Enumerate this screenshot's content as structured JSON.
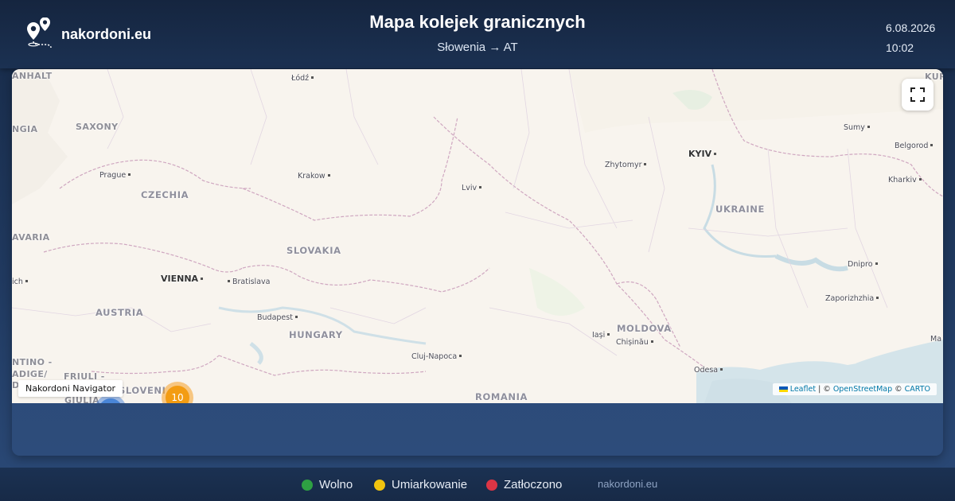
{
  "header": {
    "brand_name": "nakordoni.eu",
    "title": "Mapa kolejek granicznych",
    "subtitle": "Słowenia → AT",
    "date": "6.08.2026",
    "time": "10:02"
  },
  "map": {
    "labels": {
      "anhalt": "ANHALT",
      "lodz": "Łódź",
      "kursk": "KURSK",
      "saxony": "SAXONY",
      "ngia": "NGIA",
      "sumy": "Sumy",
      "belgorod": "Belgorod",
      "prague": "Prague",
      "krakow": "Krakow",
      "zhytomyr": "Zhytomyr",
      "kyiv": "KYIV",
      "czechia": "CZECHIA",
      "lviv": "Lviv",
      "kharkiv": "Kharkiv",
      "ukraine": "UKRAINE",
      "bavaria": "AVARIA",
      "slovakia": "SLOVAKIA",
      "dnipro": "Dnipro",
      "munich": "ich",
      "vienna": "VIENNA",
      "bratislava": "Bratislava",
      "zaporizhzhia": "Zaporizhzhia",
      "austria": "AUSTRIA",
      "budapest": "Budapest",
      "iasi": "Iași",
      "moldova": "MOLDOVA",
      "chisinau": "Chișinău",
      "hungary": "HUNGARY",
      "ma": "Ma",
      "trentino": "NTINO -",
      "adige": "ADIGE/",
      "dt": "DT",
      "cluj": "Cluj-Napoca",
      "odesa": "Odesa",
      "friuli": "FRIULI -",
      "giulia": "GIULIA",
      "slovenia": "SLOVENI",
      "romania": "ROMANIA"
    },
    "navigator_label": "Nakordoni Navigator",
    "attribution": {
      "leaflet": "Leaflet",
      "sep1": " | © ",
      "osm": "OpenStreetMap",
      "sep2": " © ",
      "carto": "CARTO"
    },
    "clusters": [
      {
        "label": "10",
        "color": "#f39c12"
      },
      {
        "label": "",
        "color": "#4a86d8"
      }
    ]
  },
  "legend": [
    {
      "label": "Wolno",
      "color": "#2ea043"
    },
    {
      "label": "Umiarkowanie",
      "color": "#f1c40f"
    },
    {
      "label": "Zatłoczono",
      "color": "#dc3545"
    }
  ],
  "footer": {
    "site": "nakordoni.eu"
  }
}
